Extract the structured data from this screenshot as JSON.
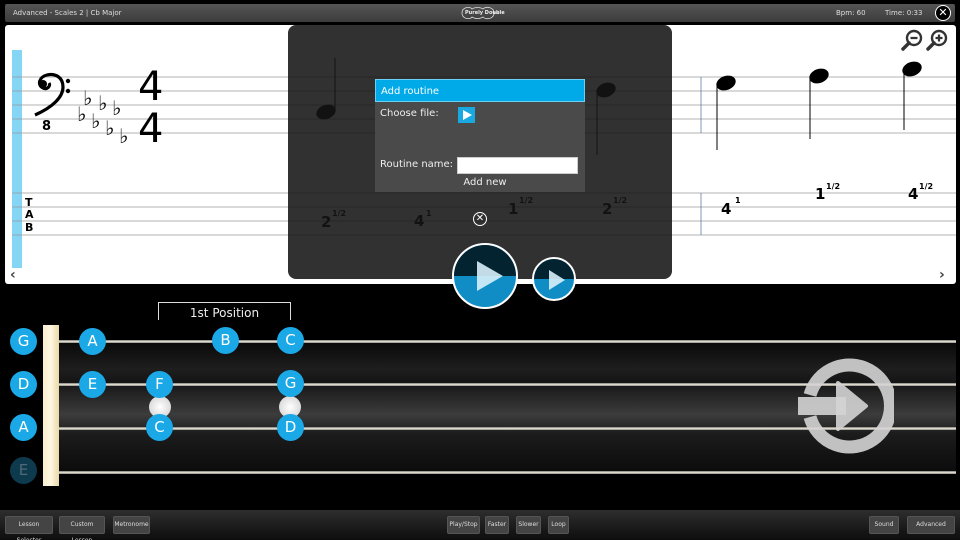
{
  "topbar": {
    "title": "Advanced - Scales 2  |  Cb Major",
    "logo_text": "Purely Double",
    "bpm": "Bpm: 60",
    "time": "Time: 0:33",
    "close_symbol": "✕"
  },
  "score": {
    "clef": "bass-8vb",
    "key_signature": "Cb Major (7 flats)",
    "time_signature": {
      "top": "4",
      "bottom": "4"
    },
    "tab_label": [
      "T",
      "A",
      "B"
    ],
    "notes": [
      {
        "tab_fret": "2",
        "finger": "1/2"
      },
      {
        "tab_fret": "4",
        "finger": "1"
      },
      {
        "tab_fret": "1",
        "finger": "1/2"
      },
      {
        "tab_fret": "2",
        "finger": "1/2"
      },
      {
        "tab_fret": "4",
        "finger": "1"
      },
      {
        "tab_fret": "1",
        "finger": "1/2"
      },
      {
        "tab_fret": "4",
        "finger": "1/2"
      }
    ],
    "nav_left": "‹",
    "nav_right": "›"
  },
  "dialog": {
    "title": "Add routine",
    "choose_file_label": "Choose file:",
    "routine_name_label": "Routine name:",
    "routine_name_value": "",
    "routine_name_placeholder": "",
    "add_new_label": "Add new",
    "close_symbol": "✕"
  },
  "fretboard": {
    "position_label": "1st Position",
    "open_strings": [
      "G",
      "D",
      "A",
      "E"
    ],
    "notes": [
      {
        "string": 0,
        "label": "A"
      },
      {
        "string": 0,
        "label": "B"
      },
      {
        "string": 0,
        "label": "C"
      },
      {
        "string": 1,
        "label": "E"
      },
      {
        "string": 1,
        "label": "F"
      },
      {
        "string": 1,
        "label": "G"
      },
      {
        "string": 2,
        "label": "C"
      },
      {
        "string": 2,
        "label": "D"
      }
    ]
  },
  "bottombar": {
    "lesson_selector": "Lesson Selector",
    "custom_lesson": "Custom Lesson",
    "metronome": "Metronome",
    "play_stop": "Play/Stop",
    "faster": "Faster",
    "slower": "Slower",
    "loop": "Loop",
    "sound": "Sound",
    "advanced": "Advanced"
  },
  "colors": {
    "accent": "#1aa8e6",
    "dialog_header": "#00a9e8",
    "highlight_bar": "#85d5f5"
  }
}
